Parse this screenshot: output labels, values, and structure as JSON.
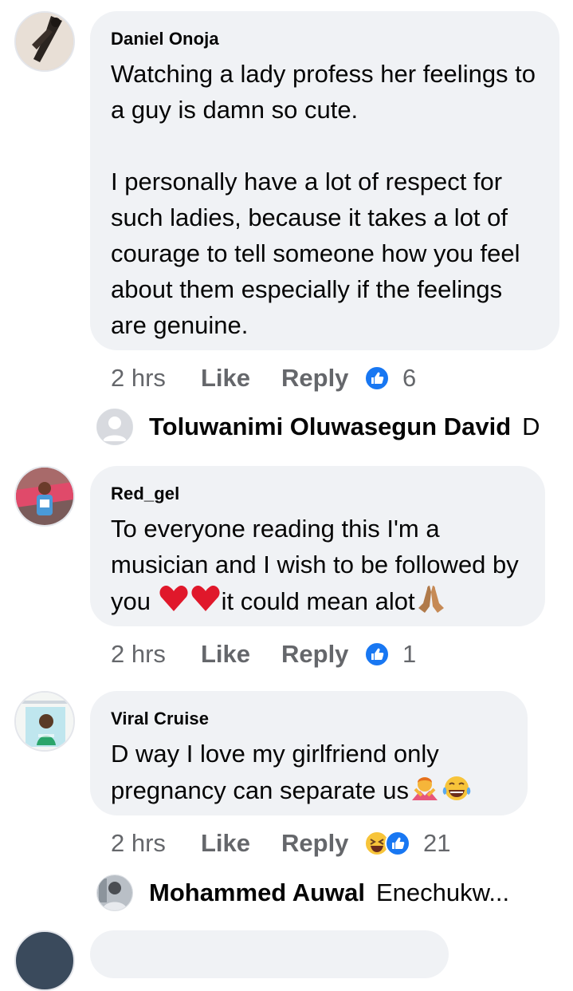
{
  "comments": [
    {
      "author": "Daniel Onoja",
      "paragraph1": "Watching a lady profess her feelings to a guy is damn so cute.",
      "paragraph2": "I personally have a lot of respect for such ladies, because it takes a lot of courage to tell someone how you feel about them especially if the feelings are genuine.",
      "time": "2 hrs",
      "like_label": "Like",
      "reply_label": "Reply",
      "reaction_count": "6"
    },
    {
      "author": "Red_gel",
      "text_a": "To everyone reading this I'm a musician and I wish to be followed by you",
      "text_b": "it could mean alot",
      "time": "2 hrs",
      "like_label": "Like",
      "reply_label": "Reply",
      "reaction_count": "1"
    },
    {
      "author": "Viral Cruise",
      "text_a": "D way I love my girlfriend only pregnancy can separate us",
      "time": "2 hrs",
      "like_label": "Like",
      "reply_label": "Reply",
      "reaction_count": "21"
    }
  ],
  "replies": [
    {
      "author": "Toluwanimi Oluwasegun David",
      "preview": "D"
    },
    {
      "author": "Mohammed Auwal",
      "preview": "Enechukw..."
    }
  ],
  "colors": {
    "bubble": "#f0f2f5",
    "meta": "#65676b",
    "like_blue": "#1877f2"
  }
}
